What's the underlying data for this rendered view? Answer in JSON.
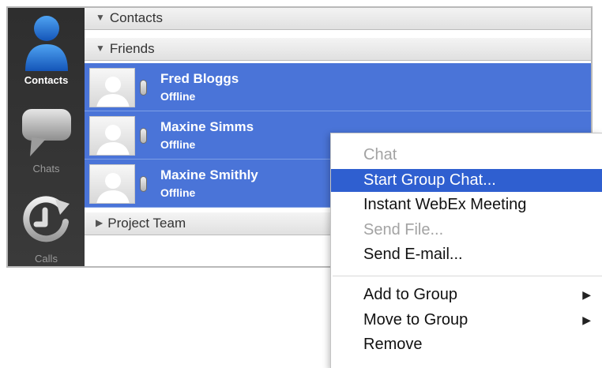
{
  "sidebar": {
    "items": [
      {
        "label": "Contacts",
        "icon": "person-icon",
        "active": true
      },
      {
        "label": "Chats",
        "icon": "speech-bubble-icon",
        "active": false
      },
      {
        "label": "Calls",
        "icon": "call-history-icon",
        "active": false
      }
    ]
  },
  "contact_list": {
    "groups": [
      {
        "label": "Contacts",
        "expanded": true
      },
      {
        "label": "Friends",
        "expanded": true
      },
      {
        "label": "Project Team",
        "expanded": false
      }
    ],
    "contacts": [
      {
        "name": "Fred Bloggs",
        "status": "Offline",
        "selected": true
      },
      {
        "name": "Maxine Simms",
        "status": "Offline",
        "selected": true
      },
      {
        "name": "Maxine Smithly",
        "status": "Offline",
        "selected": true
      }
    ]
  },
  "context_menu": {
    "items": [
      {
        "label": "Chat",
        "enabled": false
      },
      {
        "label": "Start Group Chat...",
        "enabled": true,
        "highlighted": true
      },
      {
        "label": "Instant WebEx Meeting",
        "enabled": true
      },
      {
        "label": "Send File...",
        "enabled": false
      },
      {
        "label": "Send E-mail...",
        "enabled": true
      },
      {
        "label": "Add to Group",
        "enabled": true,
        "submenu": true
      },
      {
        "label": "Move to Group",
        "enabled": true,
        "submenu": true
      },
      {
        "label": "Remove",
        "enabled": true
      }
    ]
  },
  "colors": {
    "selection_blue": "#4a74d8",
    "menu_highlight": "#2f5fd0",
    "rail_background": "#333333",
    "active_icon_blue": "#1f6fd6"
  }
}
